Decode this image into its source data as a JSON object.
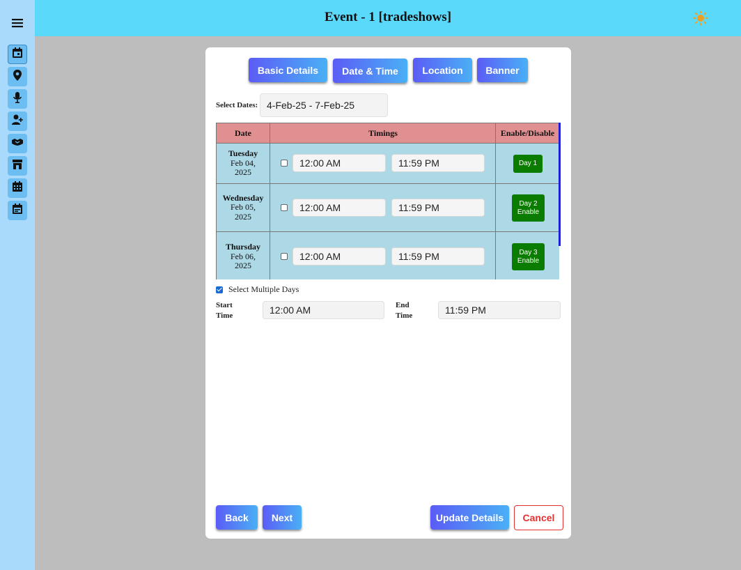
{
  "header": {
    "title": "Event - 1 [tradeshows]",
    "theme_icon": "sun-icon"
  },
  "sidebar": {
    "menu_icon": "hamburger-menu-icon",
    "items": [
      {
        "icon": "calendar-icon"
      },
      {
        "icon": "location-pin-icon"
      },
      {
        "icon": "microphone-icon"
      },
      {
        "icon": "add-user-icon"
      },
      {
        "icon": "handshake-icon"
      },
      {
        "icon": "store-icon"
      },
      {
        "icon": "calendar-grid-icon"
      },
      {
        "icon": "event-calendar-icon"
      }
    ]
  },
  "tabs": [
    "Basic Details",
    "Date & Time",
    "Location",
    "Banner"
  ],
  "select_dates": {
    "label": "Select Dates:",
    "value": "4-Feb-25 - 7-Feb-25"
  },
  "table": {
    "headers": [
      "Date",
      "Timings",
      "Enable/Disable"
    ],
    "rows": [
      {
        "dow": "Tuesday",
        "date": "Feb 04,",
        "year": "2025",
        "start": "12:00 AM",
        "end": "11:59 PM",
        "btn_line1": "Day 1",
        "btn_line2": ""
      },
      {
        "dow": "Wednesday",
        "date": "Feb 05,",
        "year": "2025",
        "start": "12:00 AM",
        "end": "11:59 PM",
        "btn_line1": "Day 2",
        "btn_line2": "Enable"
      },
      {
        "dow": "Thursday",
        "date": "Feb 06,",
        "year": "2025",
        "start": "12:00 AM",
        "end": "11:59 PM",
        "btn_line1": "Day 3",
        "btn_line2": "Enable"
      }
    ]
  },
  "multi": {
    "label": "Select Multiple Days",
    "checked": true
  },
  "range": {
    "start_label_1": "Start",
    "start_label_2": "Time",
    "start_value": "12:00 AM",
    "end_label_1": "End",
    "end_label_2": "Time",
    "end_value": "11:59 PM"
  },
  "buttons": {
    "back": "Back",
    "next": "Next",
    "update": "Update Details",
    "cancel": "Cancel"
  },
  "colors": {
    "topbar": "#5ad9fb",
    "sidebar": "#a9d9fb",
    "header_row": "#e09090",
    "row_bg": "#add8e6",
    "enable_green": "#0a7d00",
    "cancel_red": "#e53030"
  }
}
